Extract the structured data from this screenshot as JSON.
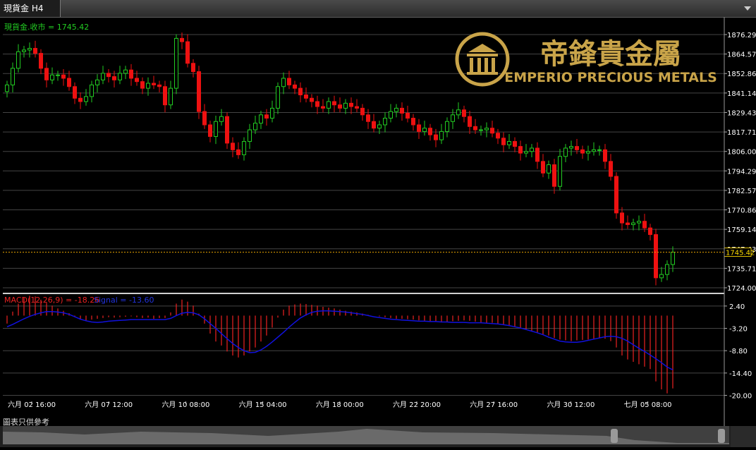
{
  "window": {
    "tab_label": "現貨金 H4",
    "disclaimer": "圖表只供參考"
  },
  "logo": {
    "chinese": "帝鋒貴金屬",
    "english": "EMPERIO PRECIOUS METALS",
    "gold": "#c9a449"
  },
  "colors": {
    "up": "#22cc22",
    "down": "#ee1111",
    "wick": "#bbbbbb",
    "grid": "#444444",
    "axis_text": "#ffffff",
    "price_line": "#e0a000",
    "macd": "#ee2222",
    "signal": "#1111dd"
  },
  "chart_data": [
    {
      "type": "candlestick",
      "label": "現貨金.收市 = 1745.42",
      "last_price": 1745.42,
      "ylim": [
        1724.0,
        1880.0
      ],
      "y_ticks": [
        "1876.29",
        "1864.57",
        "1852.86",
        "1841.14",
        "1829.43",
        "1817.71",
        "1806.00",
        "1794.29",
        "1782.57",
        "1770.86",
        "1759.14",
        "1747.43",
        "1735.71",
        "1724.00"
      ],
      "x_ticks": [
        "六月 02 16:00",
        "六月 07 12:00",
        "六月 10 08:00",
        "六月 15 04:00",
        "六月 18 00:00",
        "六月 22 20:00",
        "六月 27 16:00",
        "六月 30 12:00",
        "七月 05 08:00"
      ],
      "closes": [
        1846,
        1856,
        1866,
        1867,
        1868,
        1865,
        1856,
        1849,
        1852,
        1852,
        1850,
        1845,
        1838,
        1836,
        1839,
        1846,
        1849,
        1853,
        1851,
        1849,
        1853,
        1855,
        1850,
        1848,
        1844,
        1847,
        1846,
        1845,
        1834,
        1844,
        1874,
        1872,
        1859,
        1854,
        1830,
        1822,
        1815,
        1824,
        1827,
        1811,
        1807,
        1804,
        1812,
        1819,
        1823,
        1828,
        1826,
        1832,
        1845,
        1850,
        1846,
        1844,
        1840,
        1838,
        1836,
        1833,
        1832,
        1836,
        1834,
        1832,
        1835,
        1833,
        1832,
        1828,
        1824,
        1820,
        1822,
        1826,
        1830,
        1832,
        1829,
        1826,
        1822,
        1818,
        1820,
        1816,
        1813,
        1818,
        1824,
        1828,
        1831,
        1827,
        1821,
        1819,
        1819,
        1820,
        1817,
        1814,
        1810,
        1812,
        1809,
        1805,
        1806,
        1808,
        1800,
        1793,
        1798,
        1785,
        1803,
        1808,
        1809,
        1807,
        1805,
        1806,
        1807,
        1807,
        1800,
        1791,
        1769,
        1763,
        1762,
        1763,
        1764,
        1760,
        1756,
        1730,
        1732,
        1738,
        1745.42
      ],
      "macd_label": "MACD(12,26,9) = -18.26",
      "signal_label": "Signal = -13.60",
      "macd_ylim": [
        -22.0,
        5.0
      ],
      "macd_y_ticks": [
        "2.40",
        "-3.20",
        "-8.80",
        "-14.40",
        "-20.00"
      ],
      "macd_hist": [
        -2.0,
        1.0,
        3.0,
        4.5,
        5.0,
        4.8,
        4.0,
        3.2,
        2.5,
        1.8,
        1.2,
        0.6,
        -0.2,
        -0.8,
        -1.2,
        -1.0,
        -0.8,
        -0.6,
        -0.4,
        -0.5,
        -0.4,
        -0.3,
        -0.2,
        -0.4,
        -0.6,
        -0.5,
        -0.8,
        -0.6,
        -0.6,
        0.8,
        3.0,
        4.0,
        3.5,
        2.5,
        0.5,
        -2.0,
        -4.5,
        -6.5,
        -7.5,
        -9.0,
        -10.0,
        -10.5,
        -10.0,
        -9.0,
        -8.0,
        -6.5,
        -5.0,
        -3.0,
        -0.5,
        1.5,
        2.5,
        2.8,
        3.0,
        2.9,
        2.7,
        2.5,
        2.2,
        2.0,
        1.8,
        1.5,
        1.2,
        1.0,
        0.8,
        0.5,
        0.2,
        0.0,
        -0.2,
        -0.4,
        -0.6,
        -0.8,
        -0.8,
        -0.9,
        -1.0,
        -1.2,
        -1.3,
        -1.4,
        -1.5,
        -1.6,
        -1.5,
        -1.4,
        -1.3,
        -1.2,
        -1.3,
        -1.5,
        -1.7,
        -1.8,
        -1.8,
        -2.0,
        -2.2,
        -2.6,
        -2.8,
        -3.2,
        -3.4,
        -3.8,
        -4.2,
        -4.8,
        -5.0,
        -5.6,
        -6.0,
        -6.2,
        -6.4,
        -6.2,
        -6.1,
        -6.0,
        -5.8,
        -5.6,
        -5.8,
        -6.4,
        -8.0,
        -10.0,
        -11.0,
        -11.6,
        -12.2,
        -12.8,
        -13.4,
        -16.5,
        -18.5,
        -19.5,
        -18.26
      ],
      "signal_line": [
        -2.8,
        -2.2,
        -1.5,
        -0.8,
        -0.2,
        0.3,
        0.7,
        1.0,
        1.0,
        0.9,
        0.7,
        0.3,
        -0.3,
        -0.9,
        -1.3,
        -1.6,
        -1.7,
        -1.6,
        -1.4,
        -1.3,
        -1.2,
        -1.1,
        -1.0,
        -1.0,
        -1.0,
        -1.0,
        -1.0,
        -1.0,
        -1.0,
        -0.7,
        0.0,
        0.6,
        0.8,
        0.7,
        0.2,
        -0.8,
        -2.0,
        -3.2,
        -4.5,
        -5.8,
        -7.0,
        -8.0,
        -8.8,
        -9.3,
        -9.2,
        -8.6,
        -7.7,
        -6.6,
        -5.4,
        -4.2,
        -2.9,
        -1.7,
        -0.6,
        0.2,
        0.8,
        1.1,
        1.2,
        1.2,
        1.1,
        1.0,
        0.9,
        0.7,
        0.5,
        0.3,
        0.0,
        -0.3,
        -0.5,
        -0.7,
        -0.9,
        -1.0,
        -1.1,
        -1.2,
        -1.3,
        -1.4,
        -1.4,
        -1.5,
        -1.5,
        -1.6,
        -1.6,
        -1.7,
        -1.7,
        -1.7,
        -1.8,
        -1.8,
        -1.8,
        -1.9,
        -2.0,
        -2.1,
        -2.3,
        -2.5,
        -2.8,
        -3.1,
        -3.5,
        -3.9,
        -4.3,
        -4.8,
        -5.4,
        -5.9,
        -6.4,
        -6.6,
        -6.7,
        -6.7,
        -6.5,
        -6.2,
        -5.9,
        -5.6,
        -5.3,
        -5.2,
        -5.3,
        -5.7,
        -6.4,
        -7.3,
        -8.2,
        -9.0,
        -9.9,
        -10.8,
        -11.8,
        -12.9,
        -13.6
      ]
    }
  ]
}
